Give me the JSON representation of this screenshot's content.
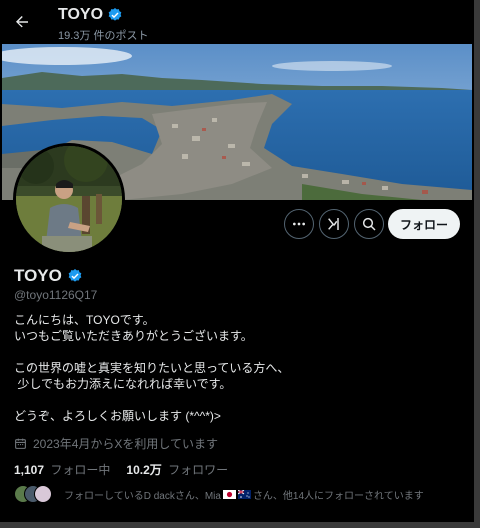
{
  "header": {
    "name": "TOYO",
    "post_count": "19.3万 件のポスト"
  },
  "profile": {
    "display_name": "TOYO",
    "handle": "@toyo1126Q17",
    "verified": true,
    "bio": [
      "こんにちは、TOYOです。",
      "いつもご覧いただきありがとうございます。",
      "",
      "この世界の嘘と真実を知りたいと思っている方へ、",
      " 少しでもお力添えになれれば幸いです。",
      "",
      "どうぞ、よろしくお願いします (*^^*)>"
    ],
    "joined": "2023年4月からXを利用しています",
    "following_count": "1,107",
    "following_label": "フォロー中",
    "followers_count": "10.2万",
    "followers_label": "フォロワー",
    "followed_by_prefix": "フォローしているD dackさん、Mia",
    "followed_by_middle": "さん、他14人にフォローされています"
  },
  "actions": {
    "more_icon": "more-icon",
    "grok_icon": "grok-icon",
    "search_icon": "search-icon",
    "follow_label": "フォロー"
  },
  "colors": {
    "background": "#000000",
    "verified": "#1d9bf0",
    "follow_bg": "#eff3f4",
    "muted": "#71767b"
  }
}
